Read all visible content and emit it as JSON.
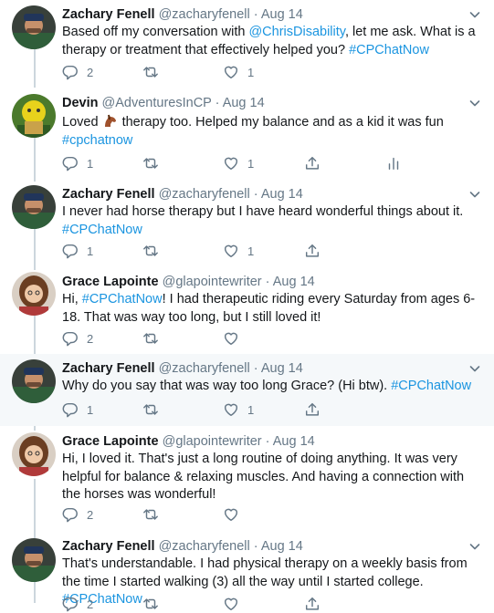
{
  "tweets": [
    {
      "name": "Zachary Fenell",
      "handle": "@zacharyfenell",
      "date": "Aug 14",
      "text_a": "Based off my conversation with ",
      "mention": "@ChrisDisability",
      "text_b": ", let me ask. What is a therapy or treatment that effectively helped you? ",
      "hashtag": "#CPChatNow",
      "replies": "2",
      "retweets": "",
      "likes": "1"
    },
    {
      "name": "Devin",
      "handle": "@AdventuresInCP",
      "date": "Aug 14",
      "text_a": "Loved ",
      "emoji": "horse-emoji",
      "text_b": " therapy too. Helped my balance and as a kid it was fun",
      "hashtag": "#cpchatnow",
      "replies": "1",
      "retweets": "",
      "likes": "1"
    },
    {
      "name": "Zachary Fenell",
      "handle": "@zacharyfenell",
      "date": "Aug 14",
      "text": "I never had horse therapy but I have heard wonderful things about it.",
      "hashtag": "#CPChatNow",
      "replies": "1",
      "retweets": "",
      "likes": "1"
    },
    {
      "name": "Grace Lapointe",
      "handle": "@glapointewriter",
      "date": "Aug 14",
      "text_a": "Hi, ",
      "hashtag": "#CPChatNow",
      "text_b": "! I had therapeutic riding every Saturday from ages 6-18. That was way too long, but I still loved it!",
      "replies": "2",
      "retweets": "",
      "likes": ""
    },
    {
      "name": "Zachary Fenell",
      "handle": "@zacharyfenell",
      "date": "Aug 14",
      "text": "Why do you say that was way too long Grace? (Hi btw). ",
      "hashtag": "#CPChatNow",
      "replies": "1",
      "retweets": "",
      "likes": "1"
    },
    {
      "name": "Grace Lapointe",
      "handle": "@glapointewriter",
      "date": "Aug 14",
      "text": "Hi, I loved it. That's just a long routine of doing anything. It was very helpful for balance & relaxing muscles. And having a connection with the horses was wonderful!",
      "replies": "2",
      "retweets": "",
      "likes": ""
    },
    {
      "name": "Zachary Fenell",
      "handle": "@zacharyfenell",
      "date": "Aug 14",
      "text": "That's understandable. I had physical therapy on a weekly basis from the time I started walking (3) all the way until I started college. ",
      "hashtag": "#CPChatNow",
      "replies": "2",
      "retweets": "",
      "likes": ""
    }
  ],
  "separator": "·",
  "icons": {
    "reply": "reply-icon",
    "retweet": "retweet-icon",
    "like": "heart-icon",
    "share": "share-icon",
    "analytics": "analytics-icon",
    "caret": "chevron-down-icon"
  },
  "colors": {
    "link": "#1b95e0",
    "muted": "#657786",
    "highlight": "#f5f8fa"
  }
}
